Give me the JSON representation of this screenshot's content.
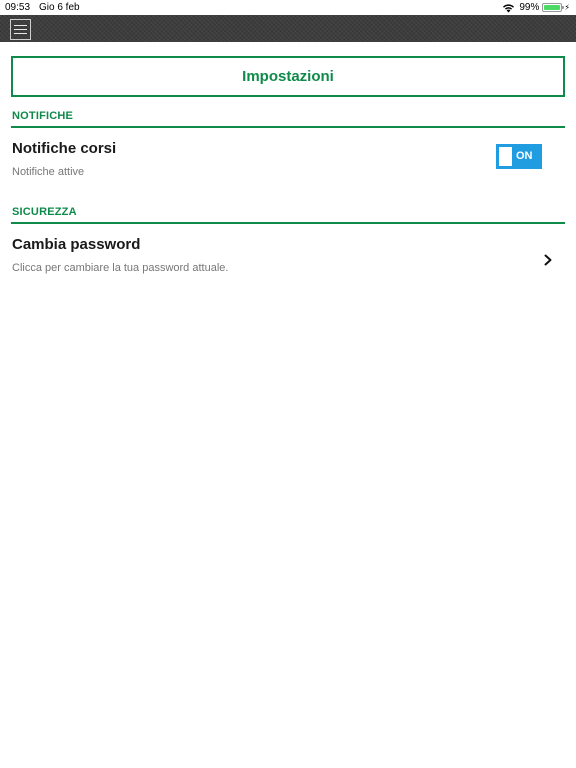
{
  "status_bar": {
    "time": "09:53",
    "date": "Gio 6 feb",
    "battery_percent": "99%",
    "battery_level": 0.99,
    "icons": [
      "wifi-icon",
      "battery-icon",
      "charging-icon"
    ]
  },
  "navbar": {
    "menu_icon": "hamburger-menu-icon"
  },
  "page": {
    "title": "Impostazioni"
  },
  "sections": {
    "notifications": {
      "header": "NOTIFICHE",
      "item": {
        "title": "Notifiche corsi",
        "subtitle": "Notifiche attive",
        "toggle_label": "ON",
        "toggle_on": true
      }
    },
    "security": {
      "header": "SICUREZZA",
      "item": {
        "title": "Cambia password",
        "subtitle": "Clicca per cambiare la tua password attuale.",
        "icon": "chevron-right-icon"
      }
    }
  },
  "colors": {
    "accent_green": "#0f8a4a",
    "toggle_blue": "#1f9de0",
    "navbar_bg": "#3d3d3d",
    "battery_green": "#4cd964"
  }
}
